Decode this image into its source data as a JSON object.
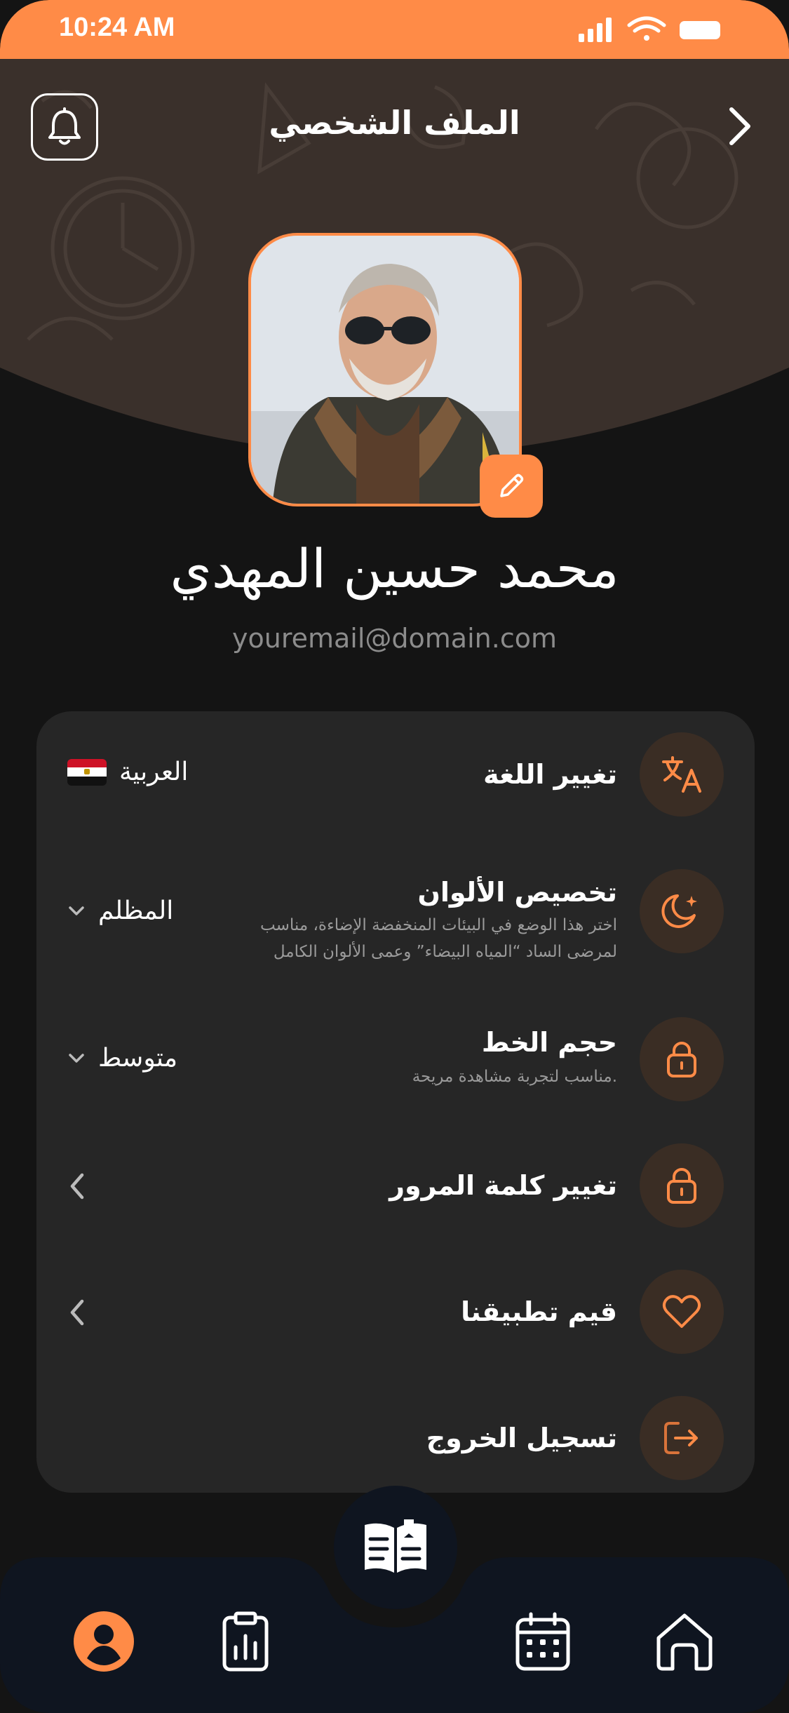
{
  "status_bar": {
    "time": "10:24 AM"
  },
  "header": {
    "title": "الملف الشخصي"
  },
  "profile": {
    "name": "محمد حسين المهدي",
    "email": "youremail@domain.com"
  },
  "settings": [
    {
      "title": "تغيير اللغة",
      "description": "",
      "value": "العربية",
      "icon": "translate-icon"
    },
    {
      "title": "تخصيص الألوان",
      "description_line1": "اختر هذا الوضع في البيئات المنخفضة الإضاءة، مناسب",
      "description_line2": "لمرضى الساد “المياه البيضاء” وعمى الألوان الكامل",
      "value": "المظلم",
      "icon": "moon-icon"
    },
    {
      "title": "حجم الخط",
      "description": "مناسب لتجربة مشاهدة مريحة.",
      "value": "متوسط",
      "icon": "lock-icon"
    },
    {
      "title": "تغيير كلمة المرور",
      "icon": "lock-icon"
    },
    {
      "title": "قيم تطبيقنا",
      "icon": "heart-icon"
    },
    {
      "title": "تسجيل الخروج",
      "icon": "logout-icon"
    }
  ],
  "colors": {
    "accent": "#FF8B47",
    "background": "#141414",
    "card": "#262626",
    "nav": "#0f1520"
  },
  "nav": [
    "profile-icon",
    "report-icon",
    "book-icon",
    "calendar-icon",
    "home-icon"
  ]
}
